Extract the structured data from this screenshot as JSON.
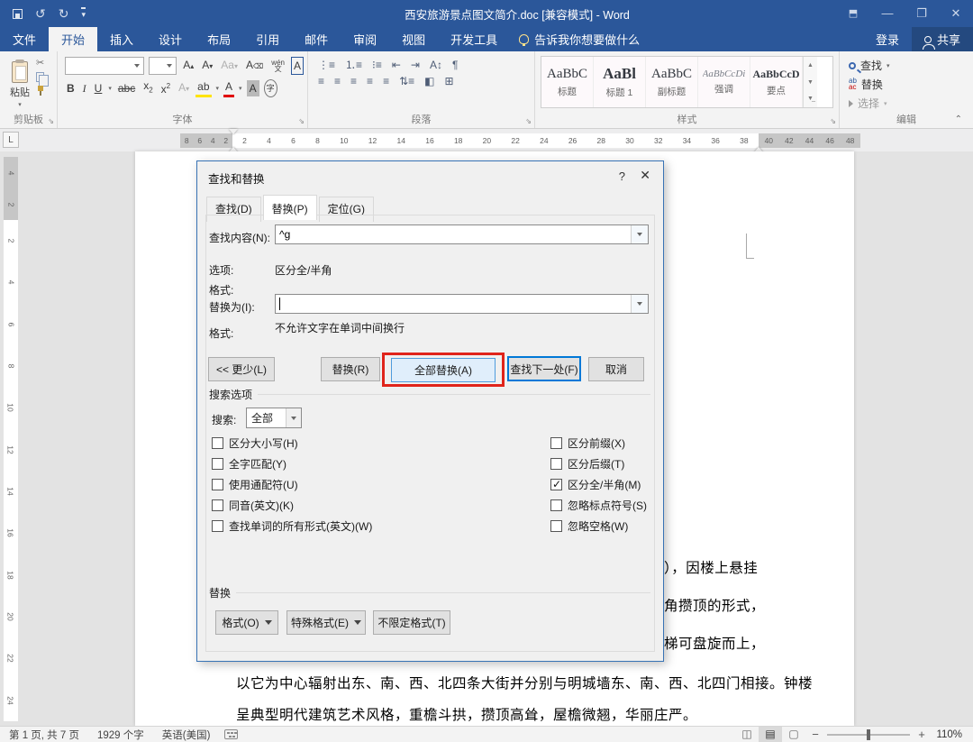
{
  "title_bar": {
    "title": "西安旅游景点图文简介.doc [兼容模式] - Word",
    "undo_icon": "↺",
    "redo_icon": "↻",
    "minimize": "—",
    "restore": "❐",
    "close": "✕",
    "ribbon_options": "⬒"
  },
  "menu": {
    "tabs": [
      {
        "label": "文件"
      },
      {
        "label": "开始",
        "active": true
      },
      {
        "label": "插入"
      },
      {
        "label": "设计"
      },
      {
        "label": "布局"
      },
      {
        "label": "引用"
      },
      {
        "label": "邮件"
      },
      {
        "label": "审阅"
      },
      {
        "label": "视图"
      },
      {
        "label": "开发工具"
      }
    ],
    "tell_me": "告诉我你想要做什么",
    "sign_in": "登录",
    "share": "共享"
  },
  "ribbon": {
    "clipboard": {
      "label": "剪贴板",
      "paste": "粘贴",
      "cut_icon": "✂"
    },
    "font_group": {
      "label": "字体",
      "grow": "A",
      "shrink": "A",
      "case": "Aa",
      "phonetic_top": "wén",
      "phonetic_bottom": "文",
      "char_border": "A",
      "bold": "B",
      "italic": "I",
      "underline": "U",
      "strike": "abc",
      "subscript": "x",
      "superscript": "x",
      "effects": "A",
      "highlight": "ab",
      "font_color": "A",
      "shading": "A",
      "enclose": "字"
    },
    "paragraph": {
      "label": "段落",
      "bullets": "⋮≡",
      "numbering": "⒈≡",
      "multilevel": "⁝≡",
      "outdent": "⇤",
      "indent": "⇥",
      "sort": "A↕",
      "marks": "¶",
      "align1": "≡",
      "align2": "≡",
      "align3": "≡",
      "align4": "≡",
      "align5": "≡",
      "spacing": "⇅≡",
      "shade": "◧",
      "borders": "⊞"
    },
    "styles": {
      "label": "样式",
      "items": [
        {
          "preview": "AaBbC",
          "label": "标题"
        },
        {
          "preview": "AaBl",
          "label": "标题 1",
          "cls": "s-h1"
        },
        {
          "preview": "AaBbC",
          "label": "副标题"
        },
        {
          "preview": "AaBbCcDi",
          "label": "强调",
          "cls": "s-emph"
        },
        {
          "preview": "AaBbCcD",
          "label": "要点",
          "cls": "s-key"
        }
      ]
    },
    "editing": {
      "label": "编辑",
      "find": "查找",
      "replace": "替换",
      "select": "选择"
    }
  },
  "ruler": {
    "h_left": [
      "8",
      "6",
      "4",
      "2"
    ],
    "h_mid": [
      "2",
      "4",
      "6",
      "8",
      "10",
      "12",
      "14",
      "16",
      "18",
      "20",
      "22",
      "24",
      "26",
      "28",
      "30",
      "32",
      "34",
      "36",
      "38"
    ],
    "h_right": [
      "40",
      "42",
      "44",
      "46",
      "48"
    ],
    "v_top": [
      "4",
      "2"
    ],
    "v_mid": [
      "2",
      "4",
      "6",
      "8",
      "10",
      "12",
      "14",
      "16",
      "18",
      "20",
      "22",
      "24"
    ],
    "tab_selector": "L"
  },
  "dialog": {
    "title": "查找和替换",
    "help": "?",
    "close": "✕",
    "tabs": [
      {
        "label": "查找(D)"
      },
      {
        "label": "替换(P)",
        "active": true
      },
      {
        "label": "定位(G)"
      }
    ],
    "find_label": "查找内容(N):",
    "find_value": "^g",
    "options_label": "选项:",
    "options_value": "区分全/半角",
    "format_label": "格式:",
    "replace_label": "替换为(I):",
    "replace_format_label": "格式:",
    "replace_format_value": "不允许文字在单词中间换行",
    "btn_less": "<< 更少(L)",
    "btn_replace": "替换(R)",
    "btn_replace_all": "全部替换(A)",
    "btn_find_next": "查找下一处(F)",
    "btn_cancel": "取消",
    "search_options_label": "搜索选项",
    "search_label": "搜索:",
    "search_value": "全部",
    "checks_left": [
      {
        "label": "区分大小写(H)"
      },
      {
        "label": "全字匹配(Y)"
      },
      {
        "label": "使用通配符(U)"
      },
      {
        "label": "同音(英文)(K)"
      },
      {
        "label": "查找单词的所有形式(英文)(W)"
      }
    ],
    "checks_right": [
      {
        "label": "区分前缀(X)"
      },
      {
        "label": "区分后缀(T)"
      },
      {
        "label": "区分全/半角(M)",
        "checked": true
      },
      {
        "label": "忽略标点符号(S)"
      },
      {
        "label": "忽略空格(W)"
      }
    ],
    "replace_group_label": "替换",
    "btn_format": "格式(O)",
    "btn_special": "特殊格式(E)",
    "btn_no_format": "不限定格式(T)"
  },
  "document": {
    "fragments": [
      {
        "text": "），因楼上悬挂"
      },
      {
        "text": "角攒顶的形式，"
      },
      {
        "text": "梯可盘旋而上，"
      }
    ],
    "lines": [
      "以它为中心辐射出东、南、西、北四条大街并分别与明城墙东、南、西、北四门相接。钟楼",
      "呈典型明代建筑艺术风格，重檐斗拱，攒顶高耸，屋檐微翘，华丽庄严。"
    ]
  },
  "status_bar": {
    "page": "第 1 页, 共 7 页",
    "words": "1929 个字",
    "language": "英语(美国)",
    "zoom_out": "−",
    "zoom_in": "+",
    "zoom": "110%"
  },
  "colors": {
    "titlebar": "#2b579a",
    "annotation_red": "#e0241b",
    "default_button_blue": "#0078d7"
  }
}
